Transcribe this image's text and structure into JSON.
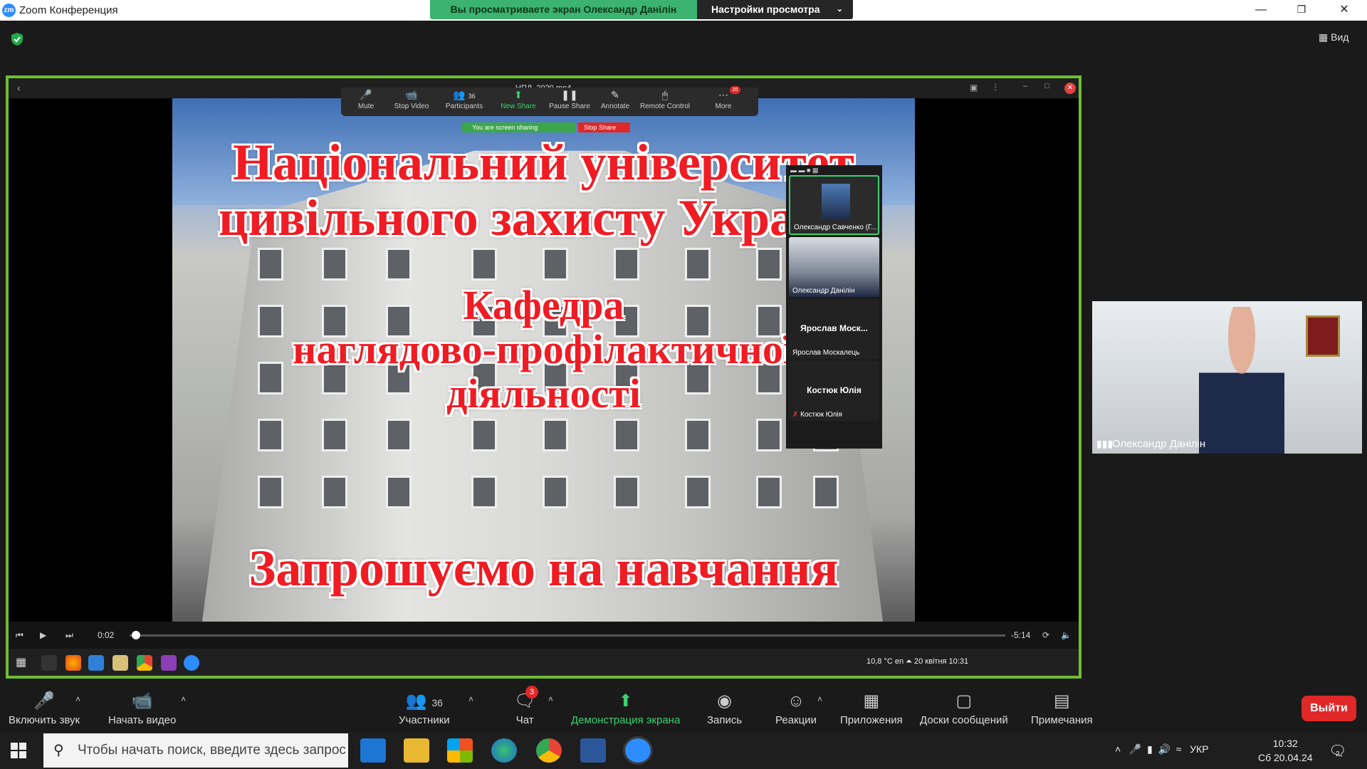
{
  "window": {
    "app_title": "Zoom Конференция",
    "logo_text": "zm",
    "banner_viewing": "Вы просматриваете экран Олександр Данілін",
    "view_options": "Настройки просмотра",
    "view_toggle": "Вид"
  },
  "share": {
    "file_title": "НПД_2020.mp4",
    "toolbar": [
      {
        "label": "Mute",
        "icon": "microphone-icon"
      },
      {
        "label": "Stop Video",
        "icon": "camera-icon"
      },
      {
        "label": "Participants",
        "icon": "participants-icon",
        "count": "36"
      },
      {
        "label": "New Share",
        "icon": "share-icon"
      },
      {
        "label": "Pause Share",
        "icon": "pause-icon"
      },
      {
        "label": "Annotate",
        "icon": "pen-icon"
      },
      {
        "label": "Remote Control",
        "icon": "mouse-icon"
      },
      {
        "label": "More",
        "icon": "more-icon",
        "badge": "20"
      }
    ],
    "sharing_status": "You are screen sharing",
    "stop_share": "Stop Share",
    "video_lines": [
      "Національний університет",
      "цивільного захисту України",
      "Кафедра",
      "наглядово-профілактичної",
      "діяльності",
      "Запрошуємо на навчання"
    ],
    "player": {
      "current_time": "0:02",
      "remaining_time": "-5:14",
      "progress_fraction": 0.006
    },
    "remote_tray": "10,8 °C en ⏶   20 квітня  10:31",
    "mini_participants": [
      {
        "name": "Олександр Савченко (Г...",
        "has_video": true
      },
      {
        "name": "Олександр Данілін",
        "has_video": true
      },
      {
        "title": "Ярослав Моск...",
        "name": "Ярослав Москалець",
        "has_video": false
      },
      {
        "title": "Костюк Юлія",
        "name": "Костюк Юлія",
        "has_video": false
      }
    ]
  },
  "self_video": {
    "name": "Олександр Данілін"
  },
  "bottom_toolbar": {
    "mute": "Включить звук",
    "video": "Начать видео",
    "participants": "Участники",
    "participants_count": "36",
    "chat": "Чат",
    "chat_badge": "3",
    "share": "Демонстрация экрана",
    "record": "Запись",
    "reactions": "Реакции",
    "apps": "Приложения",
    "boards": "Доски сообщений",
    "notes": "Примечания",
    "leave": "Выйти"
  },
  "taskbar": {
    "search_placeholder": "Чтобы начать поиск, введите здесь запрос",
    "lang": "УКР",
    "time": "10:32",
    "date": "Сб 20.04.24",
    "notif_count": "2"
  },
  "colors": {
    "accent": "#2d8cff",
    "share_border": "#6fbd35",
    "banner": "#3cb371",
    "leave": "#e02828"
  }
}
